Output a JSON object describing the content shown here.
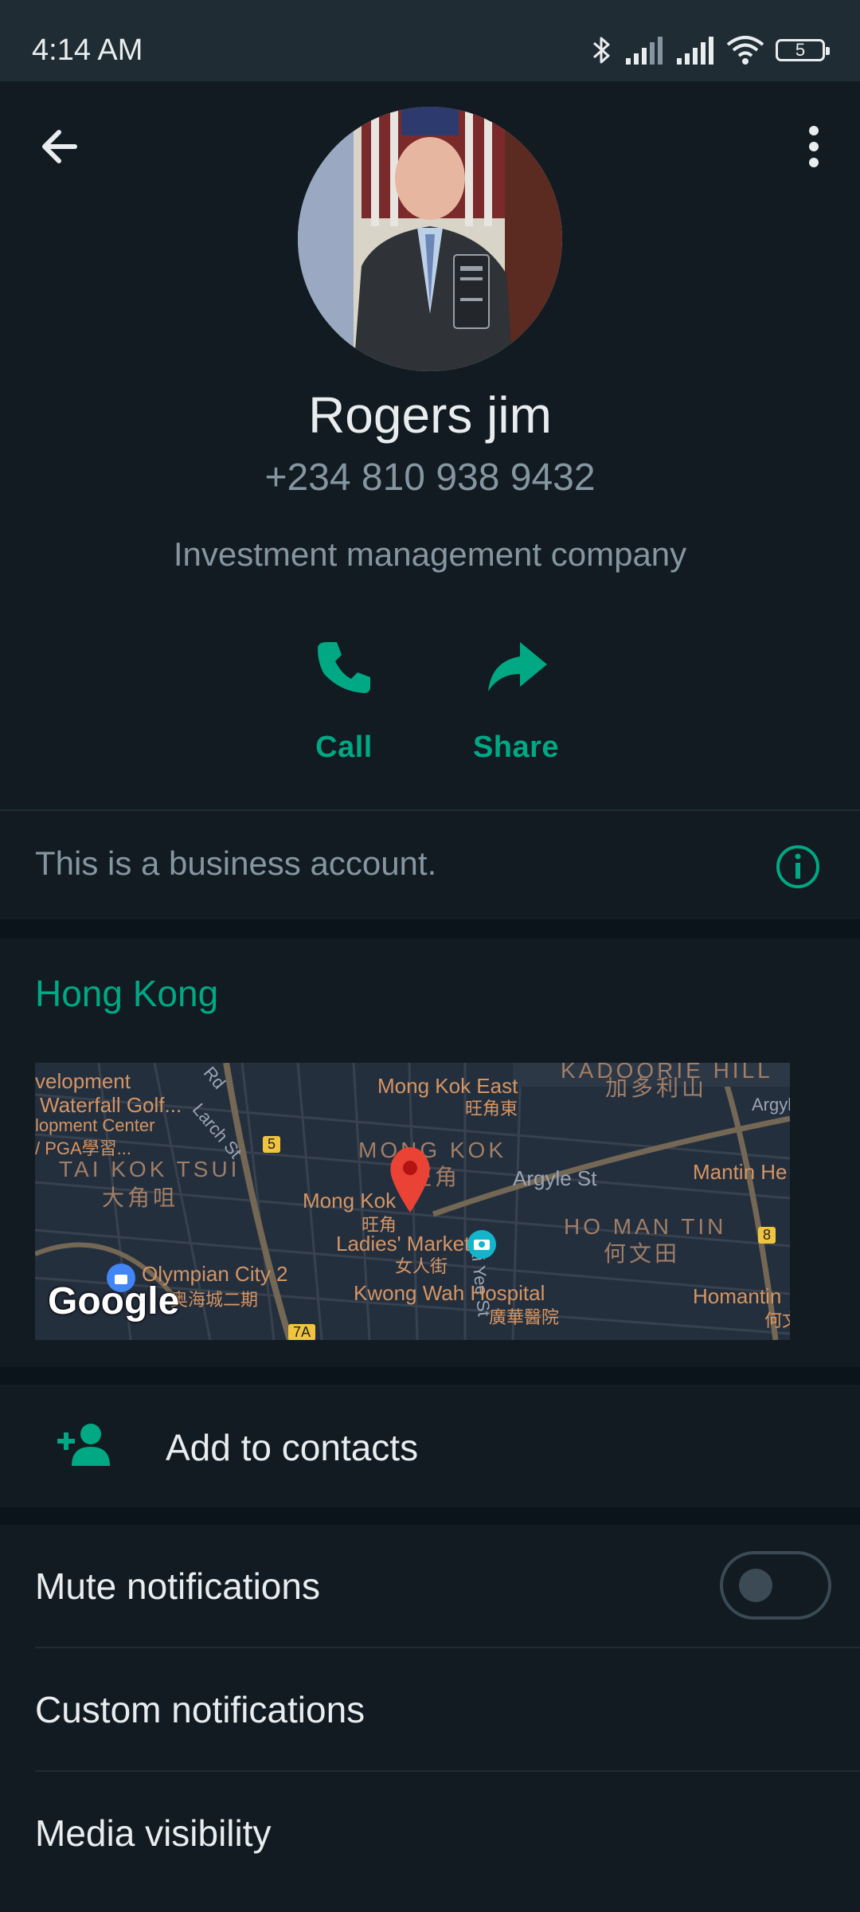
{
  "status_bar": {
    "time": "4:14 AM",
    "battery_level": "5",
    "icons": [
      "bluetooth-icon",
      "signal-icon",
      "signal-icon",
      "wifi-icon",
      "battery-icon"
    ]
  },
  "header": {
    "back_icon": "arrow-left-icon",
    "menu_icon": "more-vert-icon"
  },
  "contact": {
    "name": "Rogers jim",
    "phone": "+234 810 938 9432",
    "about": "Investment management company"
  },
  "actions": [
    {
      "label": "Call",
      "icon": "phone-icon"
    },
    {
      "label": "Share",
      "icon": "share-icon"
    }
  ],
  "business_note": {
    "text": "This is a business account.",
    "icon": "info-icon"
  },
  "location": {
    "title": "Hong Kong",
    "map": {
      "attribution": "Google",
      "labels": {
        "development": "velopment",
        "waterfall": "Waterfall Golf...",
        "opment_center": "lopment Center",
        "pga": "/ PGA學習...",
        "tai_kok_tsui": "TAI KOK TSUI",
        "tai_kok_tsui_zh": "大角咀",
        "mong_kok_east": "Mong Kok East",
        "mong_kok_east_zh": "旺角東",
        "kadoorie_hill": "KADOORIE HILL",
        "kadoorie_hill_zh": "加多利山",
        "argyle_corner": "Argyl",
        "mong_kok_district": "MONG KOK",
        "mong_kok_district_zh": "旺角",
        "mong_kok_station": "Mong Kok",
        "mong_kok_station_zh": "旺角",
        "argyle_st": "Argyle St",
        "mantin": "Mantin He",
        "ladies_market": "Ladies' Market",
        "ladies_market_zh": "女人街",
        "sai_yee_st": "Sai Yee St",
        "ho_man_tin": "HO MAN TIN",
        "ho_man_tin_zh": "何文田",
        "olympian_city": "Olympian City 2",
        "olympian_city_zh": "奥海城二期",
        "kwong_wah": "Kwong Wah Hospital",
        "kwong_wah_zh": "廣華醫院",
        "homantin": "Homantin",
        "homantin_zh": "何文",
        "larch_st": "Larch St",
        "rd": "Rd",
        "route_5": "5",
        "route_8": "8",
        "route_7a": "7A"
      }
    }
  },
  "add_contact": {
    "label": "Add to contacts",
    "icon": "person-add-icon"
  },
  "settings": [
    {
      "label": "Mute notifications",
      "toggle": false
    },
    {
      "label": "Custom notifications"
    },
    {
      "label": "Media visibility"
    }
  ],
  "colors": {
    "accent": "#00a884",
    "background": "#0b141a",
    "card": "#111b21",
    "secondary_text": "#8696a0"
  }
}
